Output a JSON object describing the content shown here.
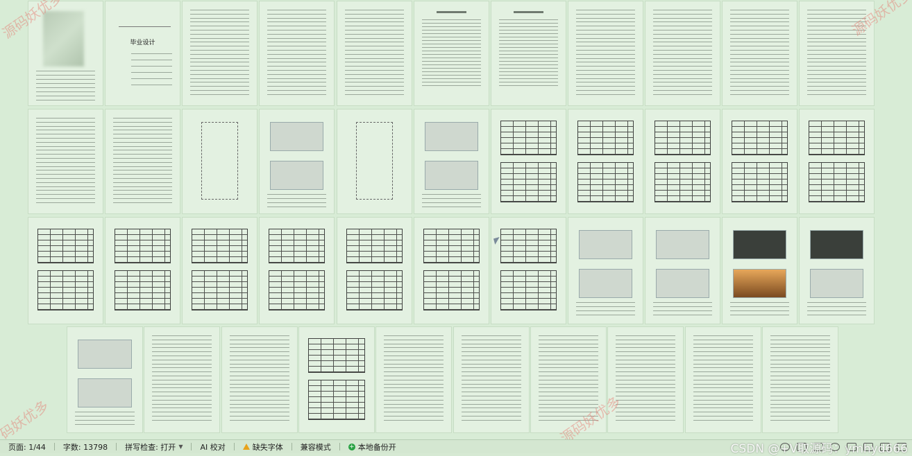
{
  "document": {
    "cover": {
      "title": "毕业设计"
    }
  },
  "watermarks": [
    "源码妖优多",
    "码妖优多",
    "源码妖优多",
    "源码妖优多"
  ],
  "statusbar": {
    "page": "页面: 1/44",
    "word_count": "字数: 13798",
    "spell_check": "拼写检查: 打开",
    "ai_check": "AI 校对",
    "missing_font": "缺失字体",
    "compat_mode": "兼容模式",
    "backup": "本地备份开",
    "overlay_text": "CSDN @+V取源码：ymhyd666",
    "icons": [
      "eye-icon",
      "page-view-icon",
      "layout-icon",
      "globe-icon",
      "pen-icon",
      "fit-width-icon",
      "zoom-in-icon",
      "fullscreen-icon"
    ]
  },
  "colors": {
    "background": "#d8ecd6",
    "page": "#e3f1e1",
    "warning": "#e8a21a",
    "ok": "#27a142"
  }
}
